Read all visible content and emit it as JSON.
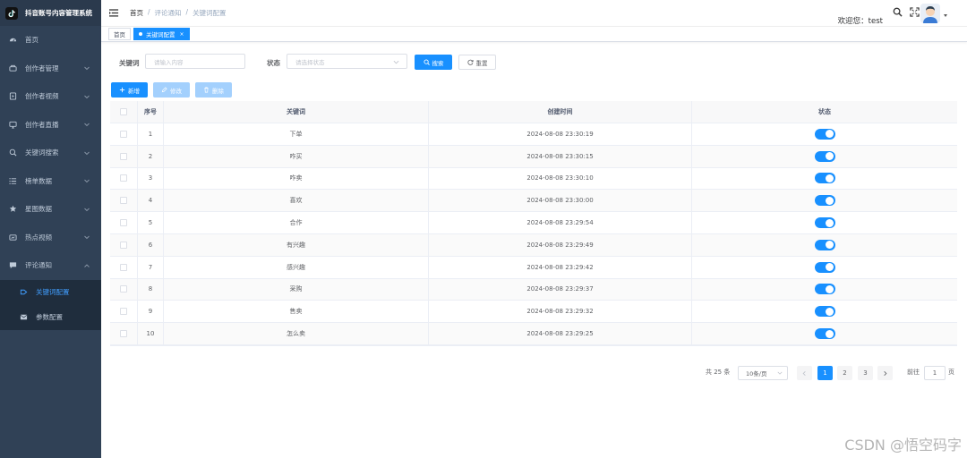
{
  "app": {
    "title": "抖音账号内容管理系统"
  },
  "sidebar": {
    "items": [
      {
        "label": "首页",
        "icon": "dashboard-icon"
      },
      {
        "label": "创作者管理",
        "icon": "creator-icon"
      },
      {
        "label": "创作者视频",
        "icon": "video-icon"
      },
      {
        "label": "创作者直播",
        "icon": "monitor-icon"
      },
      {
        "label": "关键词搜索",
        "icon": "search-icon"
      },
      {
        "label": "榜单数据",
        "icon": "list-icon"
      },
      {
        "label": "星图数据",
        "icon": "star-icon"
      },
      {
        "label": "热点视频",
        "icon": "hot-video-icon"
      },
      {
        "label": "评论通知",
        "icon": "message-icon"
      }
    ],
    "submenu": [
      {
        "label": "关键词配置",
        "icon": "keyword-config-icon",
        "active": true
      },
      {
        "label": "参数配置",
        "icon": "mail-icon",
        "active": false
      }
    ]
  },
  "header": {
    "breadcrumb": [
      "首页",
      "/",
      "评论通知",
      "/",
      "关键词配置"
    ],
    "welcome": "欢迎您：test"
  },
  "tags": [
    {
      "label": "首页",
      "active": false
    },
    {
      "label": "关键词配置",
      "active": true,
      "close": "×"
    }
  ],
  "search": {
    "keyword_label": "关键词",
    "keyword_placeholder": "请输入内容",
    "status_label": "状态",
    "status_placeholder": "请选择状态",
    "search_button": "搜索",
    "reset_button": "重置"
  },
  "toolbar": {
    "add_label": "新增",
    "edit_label": "修改",
    "delete_label": "删除"
  },
  "table": {
    "columns": [
      "序号",
      "关键词",
      "创建时间",
      "状态"
    ],
    "rows": [
      {
        "idx": "1",
        "keyword": "下单",
        "created": "2024-08-08 23:30:19",
        "enabled": true
      },
      {
        "idx": "2",
        "keyword": "咋买",
        "created": "2024-08-08 23:30:15",
        "enabled": true
      },
      {
        "idx": "3",
        "keyword": "咋卖",
        "created": "2024-08-08 23:30:10",
        "enabled": true
      },
      {
        "idx": "4",
        "keyword": "喜欢",
        "created": "2024-08-08 23:30:00",
        "enabled": true
      },
      {
        "idx": "5",
        "keyword": "合作",
        "created": "2024-08-08 23:29:54",
        "enabled": true
      },
      {
        "idx": "6",
        "keyword": "有兴趣",
        "created": "2024-08-08 23:29:49",
        "enabled": true
      },
      {
        "idx": "7",
        "keyword": "感兴趣",
        "created": "2024-08-08 23:29:42",
        "enabled": true
      },
      {
        "idx": "8",
        "keyword": "采购",
        "created": "2024-08-08 23:29:37",
        "enabled": true
      },
      {
        "idx": "9",
        "keyword": "售卖",
        "created": "2024-08-08 23:29:32",
        "enabled": true
      },
      {
        "idx": "10",
        "keyword": "怎么卖",
        "created": "2024-08-08 23:29:25",
        "enabled": true
      }
    ]
  },
  "pagination": {
    "total": "共 25 条",
    "page_size": "10条/页",
    "pages": [
      "1",
      "2",
      "3"
    ],
    "current": "1",
    "goto_label": "前往",
    "goto_value": "1",
    "page_unit": "页"
  },
  "watermark": "CSDN @悟空码字",
  "colors": {
    "sidebar": "#304156",
    "primary": "#1890ff",
    "submenu": "#1f2d3d"
  }
}
